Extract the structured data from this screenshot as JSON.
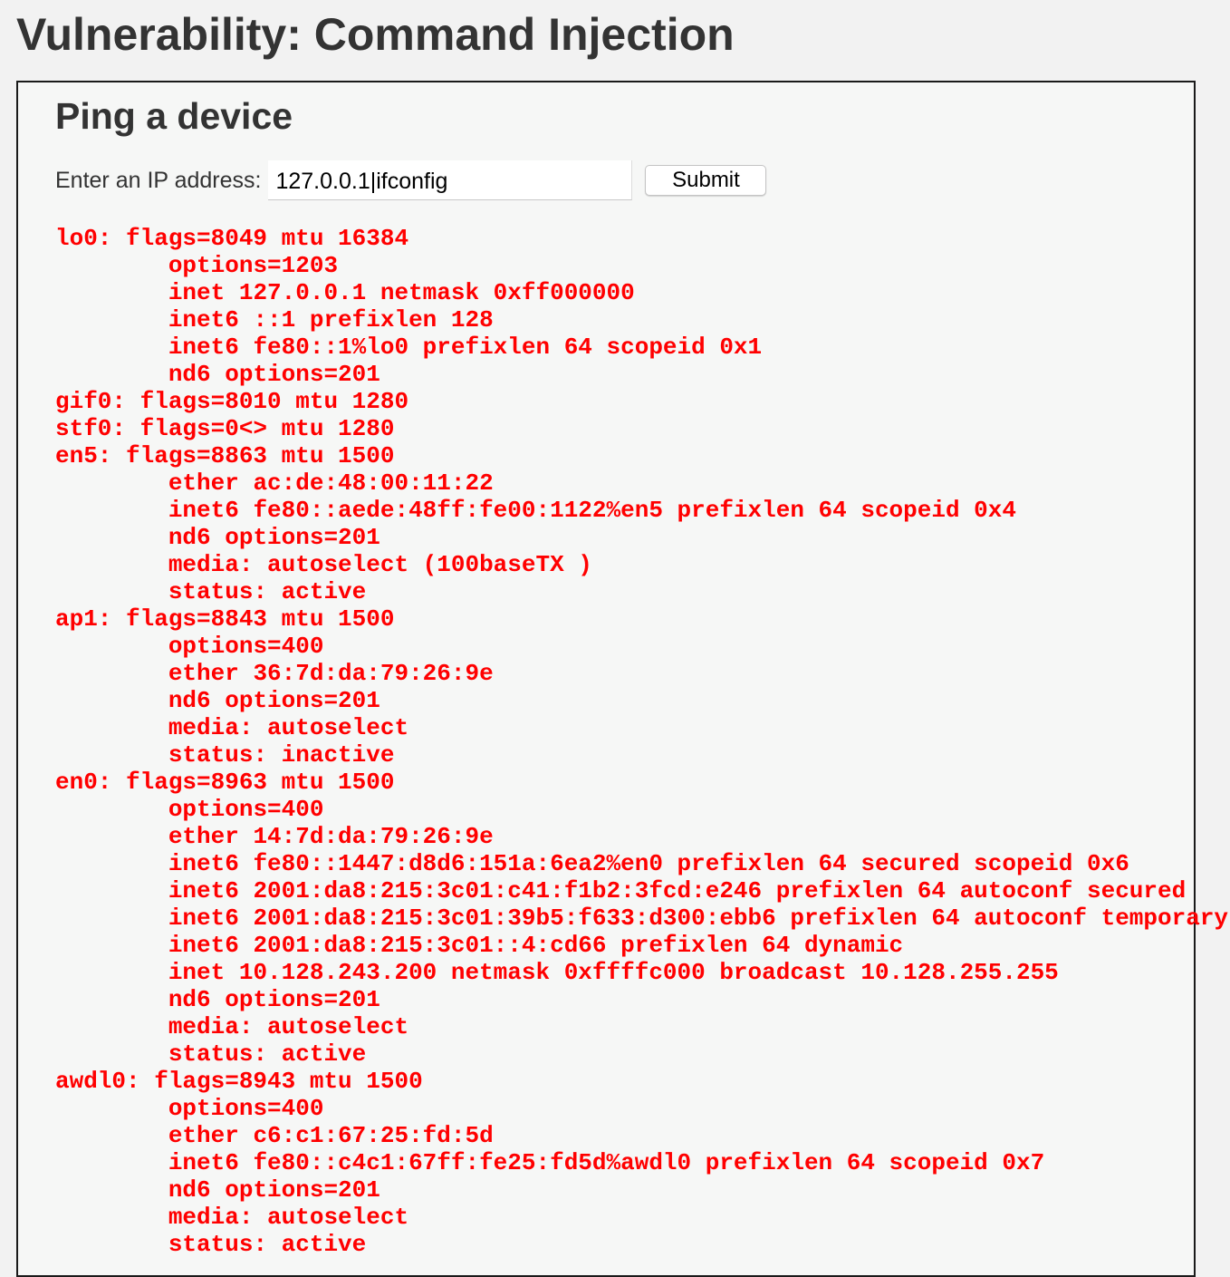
{
  "page": {
    "title": "Vulnerability: Command Injection"
  },
  "section": {
    "title": "Ping a device"
  },
  "form": {
    "label": "Enter an IP address:",
    "ip_value": "127.0.0.1|ifconfig",
    "submit_label": "Submit"
  },
  "output": {
    "text": "lo0: flags=8049 mtu 16384\n\toptions=1203\n\tinet 127.0.0.1 netmask 0xff000000\n\tinet6 ::1 prefixlen 128\n\tinet6 fe80::1%lo0 prefixlen 64 scopeid 0x1\n\tnd6 options=201\ngif0: flags=8010 mtu 1280\nstf0: flags=0<> mtu 1280\nen5: flags=8863 mtu 1500\n\tether ac:de:48:00:11:22\n\tinet6 fe80::aede:48ff:fe00:1122%en5 prefixlen 64 scopeid 0x4\n\tnd6 options=201\n\tmedia: autoselect (100baseTX )\n\tstatus: active\nap1: flags=8843 mtu 1500\n\toptions=400\n\tether 36:7d:da:79:26:9e\n\tnd6 options=201\n\tmedia: autoselect\n\tstatus: inactive\nen0: flags=8963 mtu 1500\n\toptions=400\n\tether 14:7d:da:79:26:9e\n\tinet6 fe80::1447:d8d6:151a:6ea2%en0 prefixlen 64 secured scopeid 0x6\n\tinet6 2001:da8:215:3c01:c41:f1b2:3fcd:e246 prefixlen 64 autoconf secured\n\tinet6 2001:da8:215:3c01:39b5:f633:d300:ebb6 prefixlen 64 autoconf temporary\n\tinet6 2001:da8:215:3c01::4:cd66 prefixlen 64 dynamic\n\tinet 10.128.243.200 netmask 0xffffc000 broadcast 10.128.255.255\n\tnd6 options=201\n\tmedia: autoselect\n\tstatus: active\nawdl0: flags=8943 mtu 1500\n\toptions=400\n\tether c6:c1:67:25:fd:5d\n\tinet6 fe80::c4c1:67ff:fe25:fd5d%awdl0 prefixlen 64 scopeid 0x7\n\tnd6 options=201\n\tmedia: autoselect\n\tstatus: active"
  }
}
